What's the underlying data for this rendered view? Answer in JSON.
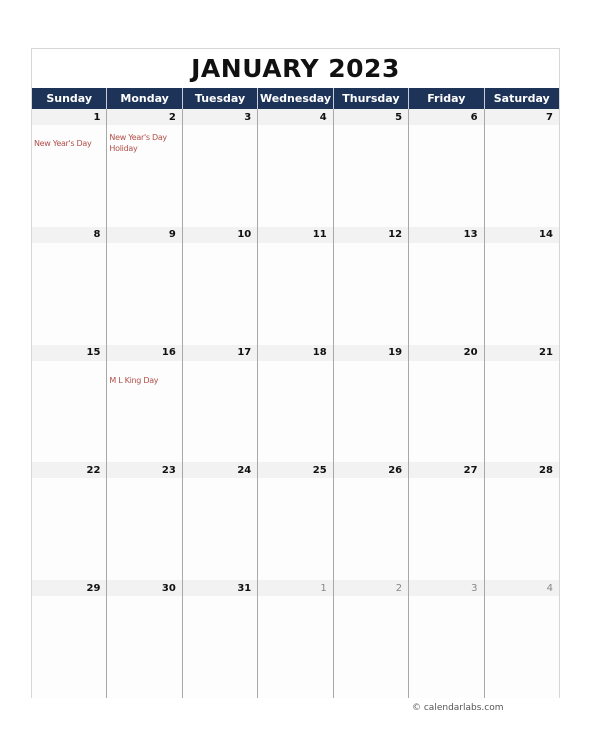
{
  "calendar": {
    "title": "JANUARY 2023",
    "weekdays": [
      "Sunday",
      "Monday",
      "Tuesday",
      "Wednesday",
      "Thursday",
      "Friday",
      "Saturday"
    ],
    "weeks": [
      [
        {
          "day": "1",
          "current": true,
          "events": [
            "New Year's Day"
          ]
        },
        {
          "day": "2",
          "current": true,
          "events": [
            "New Year's Day Holiday"
          ]
        },
        {
          "day": "3",
          "current": true,
          "events": []
        },
        {
          "day": "4",
          "current": true,
          "events": []
        },
        {
          "day": "5",
          "current": true,
          "events": []
        },
        {
          "day": "6",
          "current": true,
          "events": []
        },
        {
          "day": "7",
          "current": true,
          "events": []
        }
      ],
      [
        {
          "day": "8",
          "current": true,
          "events": []
        },
        {
          "day": "9",
          "current": true,
          "events": []
        },
        {
          "day": "10",
          "current": true,
          "events": []
        },
        {
          "day": "11",
          "current": true,
          "events": []
        },
        {
          "day": "12",
          "current": true,
          "events": []
        },
        {
          "day": "13",
          "current": true,
          "events": []
        },
        {
          "day": "14",
          "current": true,
          "events": []
        }
      ],
      [
        {
          "day": "15",
          "current": true,
          "events": []
        },
        {
          "day": "16",
          "current": true,
          "events": [
            "M L King Day"
          ]
        },
        {
          "day": "17",
          "current": true,
          "events": []
        },
        {
          "day": "18",
          "current": true,
          "events": []
        },
        {
          "day": "19",
          "current": true,
          "events": []
        },
        {
          "day": "20",
          "current": true,
          "events": []
        },
        {
          "day": "21",
          "current": true,
          "events": []
        }
      ],
      [
        {
          "day": "22",
          "current": true,
          "events": []
        },
        {
          "day": "23",
          "current": true,
          "events": []
        },
        {
          "day": "24",
          "current": true,
          "events": []
        },
        {
          "day": "25",
          "current": true,
          "events": []
        },
        {
          "day": "26",
          "current": true,
          "events": []
        },
        {
          "day": "27",
          "current": true,
          "events": []
        },
        {
          "day": "28",
          "current": true,
          "events": []
        }
      ],
      [
        {
          "day": "29",
          "current": true,
          "events": []
        },
        {
          "day": "30",
          "current": true,
          "events": []
        },
        {
          "day": "31",
          "current": true,
          "events": []
        },
        {
          "day": "1",
          "current": false,
          "events": []
        },
        {
          "day": "2",
          "current": false,
          "events": []
        },
        {
          "day": "3",
          "current": false,
          "events": []
        },
        {
          "day": "4",
          "current": false,
          "events": []
        }
      ]
    ]
  },
  "footer": {
    "copyright": "© calendarlabs.com"
  },
  "colors": {
    "header_band": "#1e3358",
    "event_text": "#b0504a",
    "date_bar": "#f2f2f2"
  }
}
